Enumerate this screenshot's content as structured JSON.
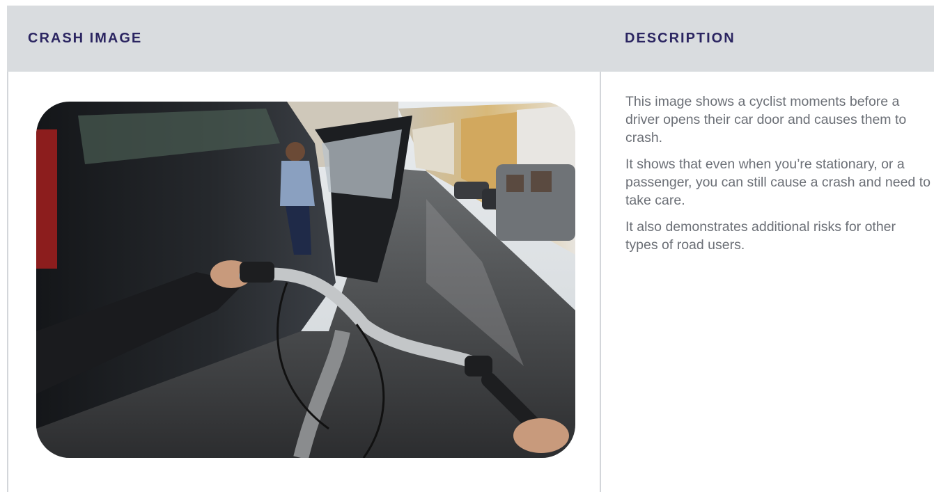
{
  "table": {
    "headers": {
      "image_col": "CRASH IMAGE",
      "description_col": "DESCRIPTION"
    },
    "row": {
      "image_alt": "Cyclist's view riding towards a car door being opened",
      "description_paragraphs": [
        "This image shows a cyclist moments before a driver opens their car door and causes them to crash.",
        "It shows that even when you’re stationary, or a passenger, you can still cause a crash and need to take care.",
        "It also demonstrates additional risks for other types of road users."
      ]
    }
  },
  "colors": {
    "header_bg": "#d9dcdf",
    "header_text": "#2b2561",
    "body_text": "#6b6f76",
    "divider": "#d3d6da"
  }
}
